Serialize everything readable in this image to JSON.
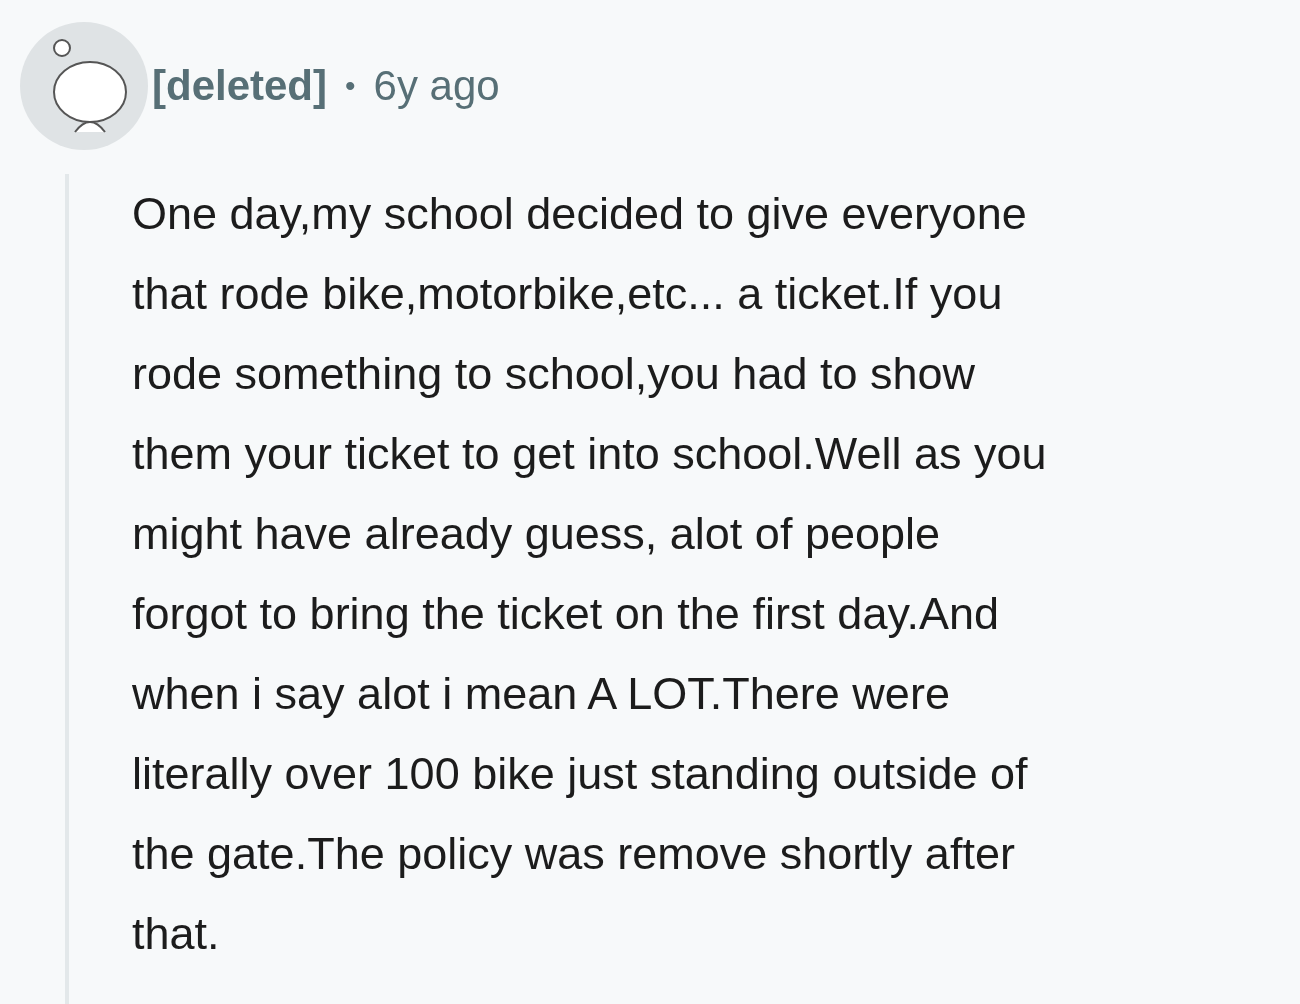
{
  "comment": {
    "author": "[deleted]",
    "separator": "•",
    "time": "6y ago",
    "body_lines": [
      "One day,my school decided to give everyone",
      "that rode bike,motorbike,etc... a ticket.If you",
      "rode something to school,you had to show",
      "them your ticket to get into school.Well as you",
      "might have already guess, alot of people",
      "forgot to bring the ticket on the first day.And",
      "when i say alot i mean A LOT.There were",
      "literally over 100 bike just standing outside of",
      "the gate.The policy was remove shortly after",
      "that."
    ]
  }
}
